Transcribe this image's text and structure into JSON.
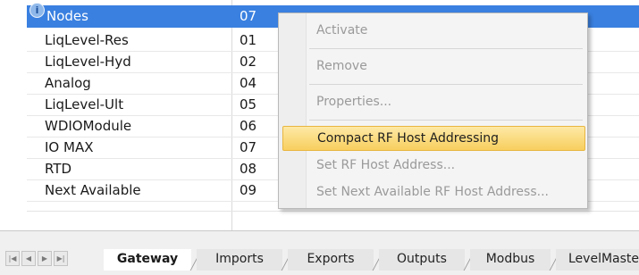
{
  "grid": {
    "selected_row": {
      "name": "Nodes",
      "value": "07"
    },
    "rows": [
      {
        "name": "LiqLevel-Res",
        "value": "01"
      },
      {
        "name": "LiqLevel-Hyd",
        "value": "02"
      },
      {
        "name": "Analog",
        "value": "04"
      },
      {
        "name": "LiqLevel-Ult",
        "value": "05"
      },
      {
        "name": "WDIOModule",
        "value": "06"
      },
      {
        "name": "IO MAX",
        "value": "07"
      },
      {
        "name": "RTD",
        "value": "08"
      },
      {
        "name": "Next Available",
        "value": "09"
      }
    ],
    "selection_color": "#3a80e0"
  },
  "context_menu": {
    "items": [
      {
        "label": "Activate",
        "enabled": false
      },
      {
        "label": "Remove",
        "enabled": false
      },
      {
        "label": "Properties...",
        "enabled": false
      },
      {
        "label": "Compact RF Host Addressing",
        "enabled": true,
        "highlighted": true
      },
      {
        "label": "Set RF Host Address...",
        "enabled": false
      },
      {
        "label": "Set Next Available RF Host Address...",
        "enabled": false
      }
    ],
    "highlight_color": "#f8cf5e"
  },
  "tabbar": {
    "nav_icons": [
      "first-page-icon",
      "prev-page-icon",
      "next-page-icon",
      "last-page-icon"
    ],
    "tabs": [
      {
        "label": "Gateway",
        "active": true
      },
      {
        "label": "Imports"
      },
      {
        "label": "Exports"
      },
      {
        "label": "Outputs"
      },
      {
        "label": "Modbus"
      },
      {
        "label": "LevelMaste"
      }
    ]
  }
}
